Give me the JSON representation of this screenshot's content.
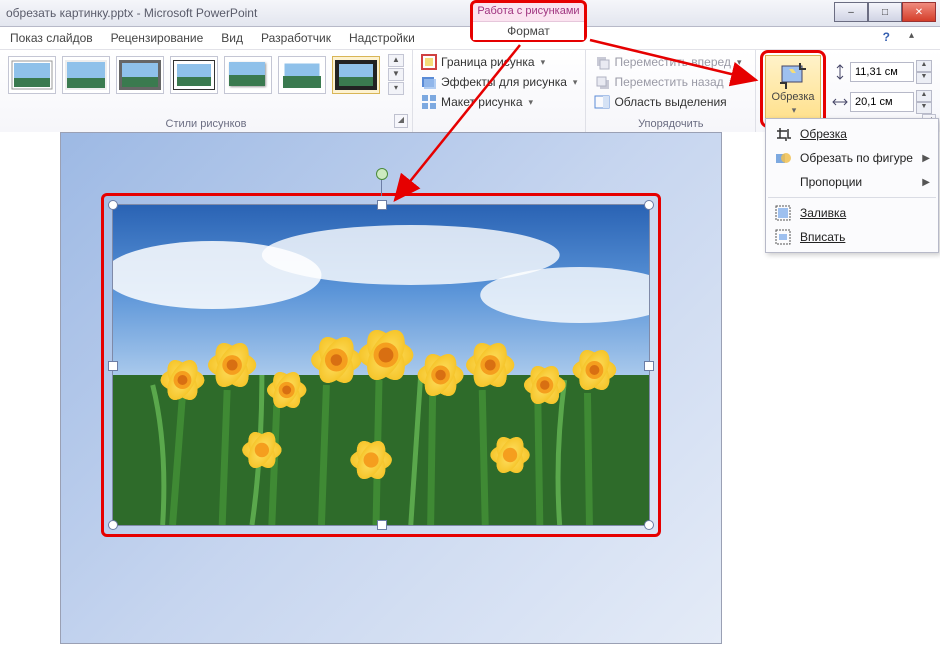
{
  "title": "обрезать картинку.pptx - Microsoft PowerPoint",
  "contextual": {
    "title": "Работа с рисунками",
    "tab": "Формат"
  },
  "menu": {
    "slideshow": "Показ слайдов",
    "review": "Рецензирование",
    "view": "Вид",
    "developer": "Разработчик",
    "addins": "Надстройки"
  },
  "ribbon": {
    "styles_label": "Стили рисунков",
    "arrange_label": "Упорядочить",
    "picture_border": "Граница рисунка",
    "picture_effects": "Эффекты для рисунка",
    "picture_layout": "Макет рисунка",
    "bring_forward": "Переместить вперед",
    "send_backward": "Переместить назад",
    "selection_pane": "Область выделения",
    "crop_label": "Обрезка",
    "height_value": "11,31 см",
    "width_value": "20,1 см"
  },
  "crop_menu": {
    "crop": "Обрезка",
    "crop_to_shape": "Обрезать по фигуре",
    "aspect": "Пропорции",
    "fill": "Заливка",
    "fit": "Вписать"
  },
  "win": {
    "min": "–",
    "max": "□",
    "close": "✕"
  }
}
